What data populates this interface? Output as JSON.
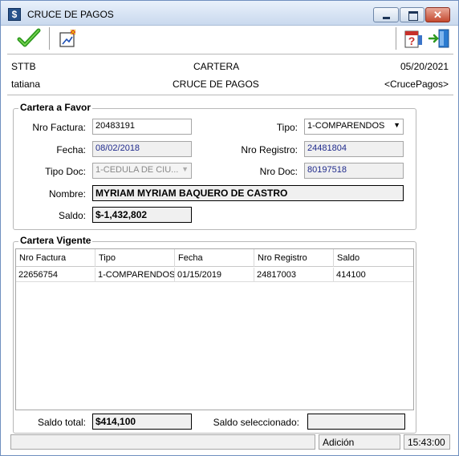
{
  "window": {
    "title": "CRUCE DE PAGOS",
    "close_glyph": "✕"
  },
  "toolbar": {
    "accept_icon": "checkmark-icon",
    "report_icon": "report-icon",
    "help_icon": "help-icon",
    "exit_icon": "exit-door-icon"
  },
  "header": {
    "company": "STTB",
    "module": "CARTERA",
    "date": "05/20/2021",
    "user": "tatiana",
    "form_name": "CRUCE DE PAGOS",
    "form_code": "<CrucePagos>"
  },
  "cartera_favor": {
    "title": "Cartera a Favor",
    "nro_factura_label": "Nro Factura:",
    "nro_factura": "20483191",
    "tipo_label": "Tipo:",
    "tipo": "1-COMPARENDOS",
    "fecha_label": "Fecha:",
    "fecha": "08/02/2018",
    "nro_registro_label": "Nro Registro:",
    "nro_registro": "24481804",
    "tipo_doc_label": "Tipo Doc:",
    "tipo_doc": "1-CEDULA DE CIU...",
    "nro_doc_label": "Nro Doc:",
    "nro_doc": "80197518",
    "nombre_label": "Nombre:",
    "nombre": "MYRIAM MYRIAM BAQUERO DE CASTRO",
    "saldo_label": "Saldo:",
    "saldo": "$-1,432,802"
  },
  "cartera_vigente": {
    "title": "Cartera Vigente",
    "columns": [
      "Nro Factura",
      "Tipo",
      "Fecha",
      "Nro Registro",
      "Saldo"
    ],
    "rows": [
      [
        "22656754",
        "1-COMPARENDOS",
        "01/15/2019",
        "24817003",
        "414100"
      ]
    ]
  },
  "totals": {
    "saldo_total_label": "Saldo total:",
    "saldo_total": "$414,100",
    "saldo_seleccionado_label": "Saldo seleccionado:",
    "saldo_seleccionado": ""
  },
  "status": {
    "message": "",
    "mode": "Adición",
    "time": "15:43:00"
  },
  "colors": {
    "readonly_text": "#1f2a8c",
    "accept_green": "#2e9a1e"
  }
}
